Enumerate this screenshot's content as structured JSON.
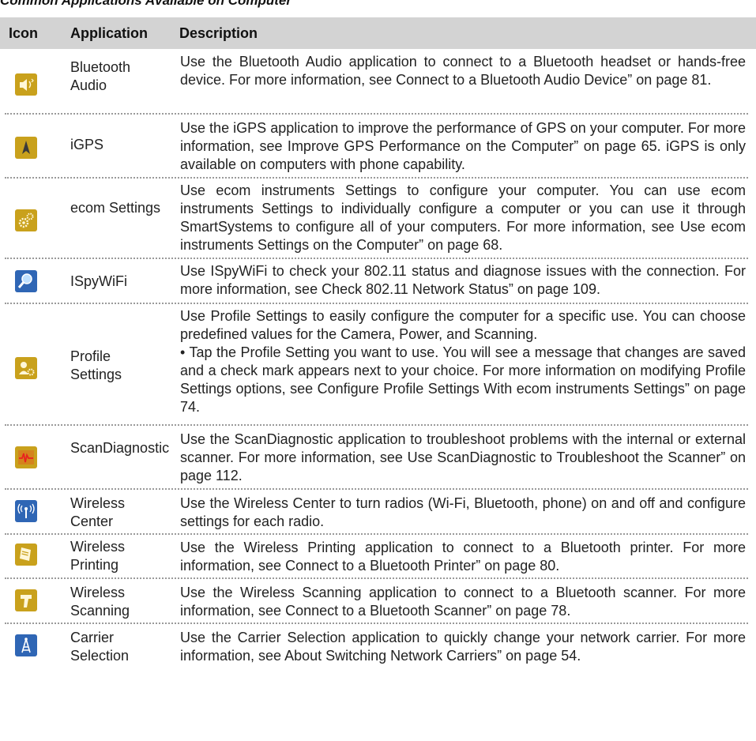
{
  "caption": "Common Applications Available on Computer",
  "header": {
    "icon": "Icon",
    "application": "Application",
    "description": "Description"
  },
  "rows": [
    {
      "icon": "speaker-bluetooth-icon",
      "app": "Bluetooth Audio",
      "desc": "Use the Bluetooth Audio application to connect to a Bluetooth headset or hands-free device. For more information, see Connect to a Bluetooth  Audio Device” on page 81."
    },
    {
      "icon": "gps-arrow-icon",
      "app": "iGPS",
      "desc": "Use the iGPS application  to improve the performance of GPS on your computer.  For more information, see Improve GPS Performance on the Computer” on page 65. iGPS is only available on computers  with phone capability."
    },
    {
      "icon": "gears-icon",
      "app": "ecom Settings",
      "desc": "Use ecom instruments Settings to configure your computer. You can use ecom instruments Settings to individually configure a computer  or you can use it through SmartSystems to configure all of your computers. For more information, see Use ecom instruments Settings on the Computer” on page 68."
    },
    {
      "icon": "magnifier-wifi-icon",
      "app": "ISpyWiFi",
      "desc": "Use ISpyWiFi to check your 802.11 status and diagnose issues with the connection. For more information, see Check 802.11 Network Status” on page 109."
    },
    {
      "icon": "profile-settings-icon",
      "app": "Profile Settings",
      "desc": "Use Profile Settings to easily configure the computer for a specific use. You can choose predefined values for the Camera, Power, and Scanning.",
      "desc2": "• Tap the Profile Setting you want to use. You will see a message that changes are saved and a check mark appears next to your choice. For more information on modifying Profile Settings options, see Configure Profile Settings With ecom instruments Settings” on page 74."
    },
    {
      "icon": "scan-diagnostic-icon",
      "app": "ScanDiagnostic",
      "desc": "Use the ScanDiagnostic application to troubleshoot problems with the internal or external scanner. For more information, see Use ScanDiagnostic to Troubleshoot the Scanner” on page 112."
    },
    {
      "icon": "wireless-antenna-icon",
      "app": "Wireless Center",
      "desc": "Use the Wireless Center to turn radios (Wi-Fi, Bluetooth, phone) on and off and configure settings for each radio."
    },
    {
      "icon": "printer-icon",
      "app": "Wireless Printing",
      "desc": "Use the Wireless Printing application to connect to a Bluetooth printer. For more information, see Connect to a Bluetooth  Printer” on page 80."
    },
    {
      "icon": "scanner-icon",
      "app": "Wireless Scanning",
      "desc": "Use the Wireless Scanning application to connect to a Bluetooth scanner. For more information, see Connect to a Bluetooth  Scanner” on page 78."
    },
    {
      "icon": "cell-tower-icon",
      "app": "Carrier Selection",
      "desc": "Use the Carrier Selection application  to quickly change your network carrier. For more information, see About Switching Network Carriers” on page 54."
    }
  ],
  "colors": {
    "header_bg": "#d3d3d3",
    "divider": "#9a9a9a",
    "icon_gold": "#c9a11c",
    "icon_blue": "#2f66b5"
  }
}
